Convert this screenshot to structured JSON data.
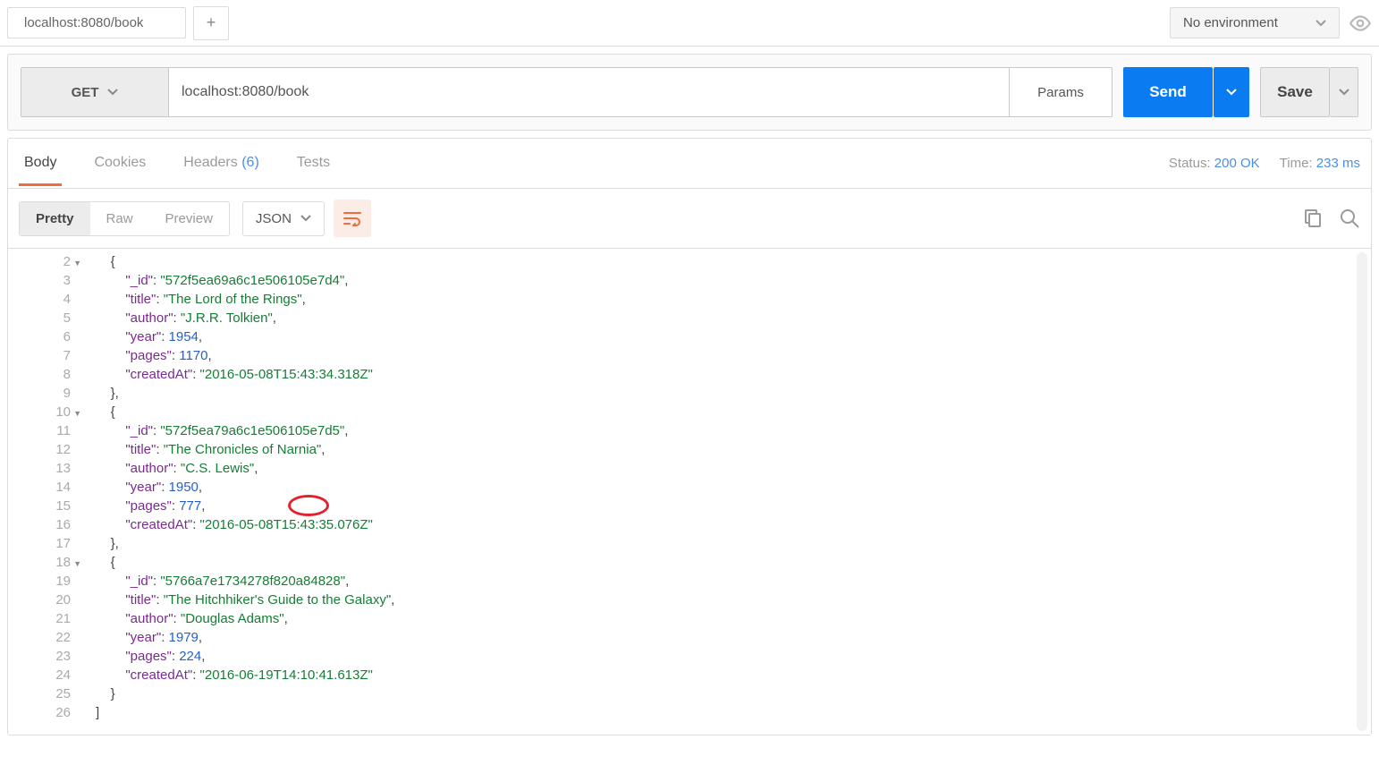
{
  "top": {
    "tab_label": "localhost:8080/book",
    "env_label": "No environment"
  },
  "request": {
    "method": "GET",
    "url": "localhost:8080/book",
    "params_label": "Params",
    "send_label": "Send",
    "save_label": "Save"
  },
  "response_tabs": {
    "body": "Body",
    "cookies": "Cookies",
    "headers": "Headers",
    "headers_count": "(6)",
    "tests": "Tests"
  },
  "meta": {
    "status_label": "Status:",
    "status_value": "200 OK",
    "time_label": "Time:",
    "time_value": "233 ms"
  },
  "view": {
    "pretty": "Pretty",
    "raw": "Raw",
    "preview": "Preview",
    "format": "JSON"
  },
  "gutter": {
    "start": 2,
    "end": 26,
    "fold_lines": [
      2,
      10,
      18
    ]
  },
  "books": [
    {
      "_id": "572f5ea69a6c1e506105e7d4",
      "title": "The Lord of the Rings",
      "author": "J.R.R. Tolkien",
      "year": 1954,
      "pages": 1170,
      "createdAt": "2016-05-08T15:43:34.318Z"
    },
    {
      "_id": "572f5ea79a6c1e506105e7d5",
      "title": "The Chronicles of Narnia",
      "author": "C.S. Lewis",
      "year": 1950,
      "pages": 777,
      "createdAt": "2016-05-08T15:43:35.076Z"
    },
    {
      "_id": "5766a7e1734278f820a84828",
      "title": "The Hitchhiker's Guide to the Galaxy",
      "author": "Douglas Adams",
      "year": 1979,
      "pages": 224,
      "createdAt": "2016-06-19T14:10:41.613Z"
    }
  ],
  "annotation": {
    "circled_path": "books.1.pages"
  }
}
